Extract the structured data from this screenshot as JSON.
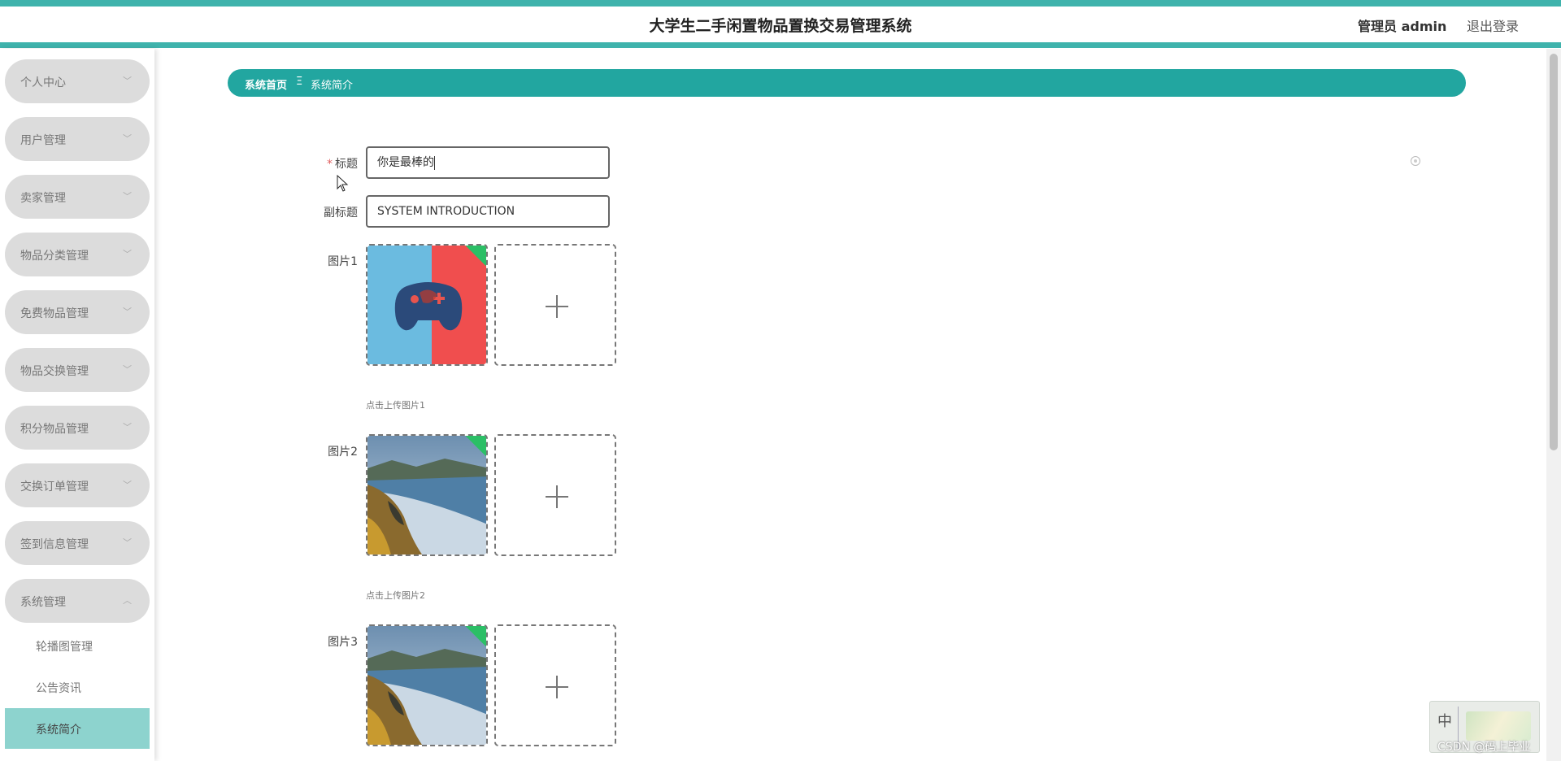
{
  "header": {
    "title": "大学生二手闲置物品置换交易管理系统",
    "user": "管理员 admin",
    "logout": "退出登录",
    "accent_color": "#3fb3ac"
  },
  "sidebar": {
    "items": [
      {
        "label": "个人中心",
        "expanded": false
      },
      {
        "label": "用户管理",
        "expanded": false
      },
      {
        "label": "卖家管理",
        "expanded": false
      },
      {
        "label": "物品分类管理",
        "expanded": false
      },
      {
        "label": "免费物品管理",
        "expanded": false
      },
      {
        "label": "物品交换管理",
        "expanded": false
      },
      {
        "label": "积分物品管理",
        "expanded": false
      },
      {
        "label": "交换订单管理",
        "expanded": false
      },
      {
        "label": "签到信息管理",
        "expanded": false
      },
      {
        "label": "系统管理",
        "expanded": true
      }
    ],
    "sub_items": [
      {
        "label": "轮播图管理",
        "active": false
      },
      {
        "label": "公告资讯",
        "active": false
      },
      {
        "label": "系统简介",
        "active": true
      }
    ]
  },
  "breadcrumb": {
    "home": "系统首页",
    "separator": "Ξ",
    "current": "系统简介"
  },
  "form": {
    "title_label": "标题",
    "title_required_mark": "*",
    "title_value": "你是最棒的",
    "subtitle_label": "副标题",
    "subtitle_value": "SYSTEM INTRODUCTION",
    "pictures": [
      {
        "label": "图片1",
        "hint": "点击上传图片1",
        "image": "gamepad-icon"
      },
      {
        "label": "图片2",
        "hint": "点击上传图片2",
        "image": "coastline-photo"
      },
      {
        "label": "图片3",
        "image": "coastline-photo"
      }
    ]
  },
  "overlay": {
    "ime_char": "中",
    "watermark": "CSDN @码上毕业"
  }
}
